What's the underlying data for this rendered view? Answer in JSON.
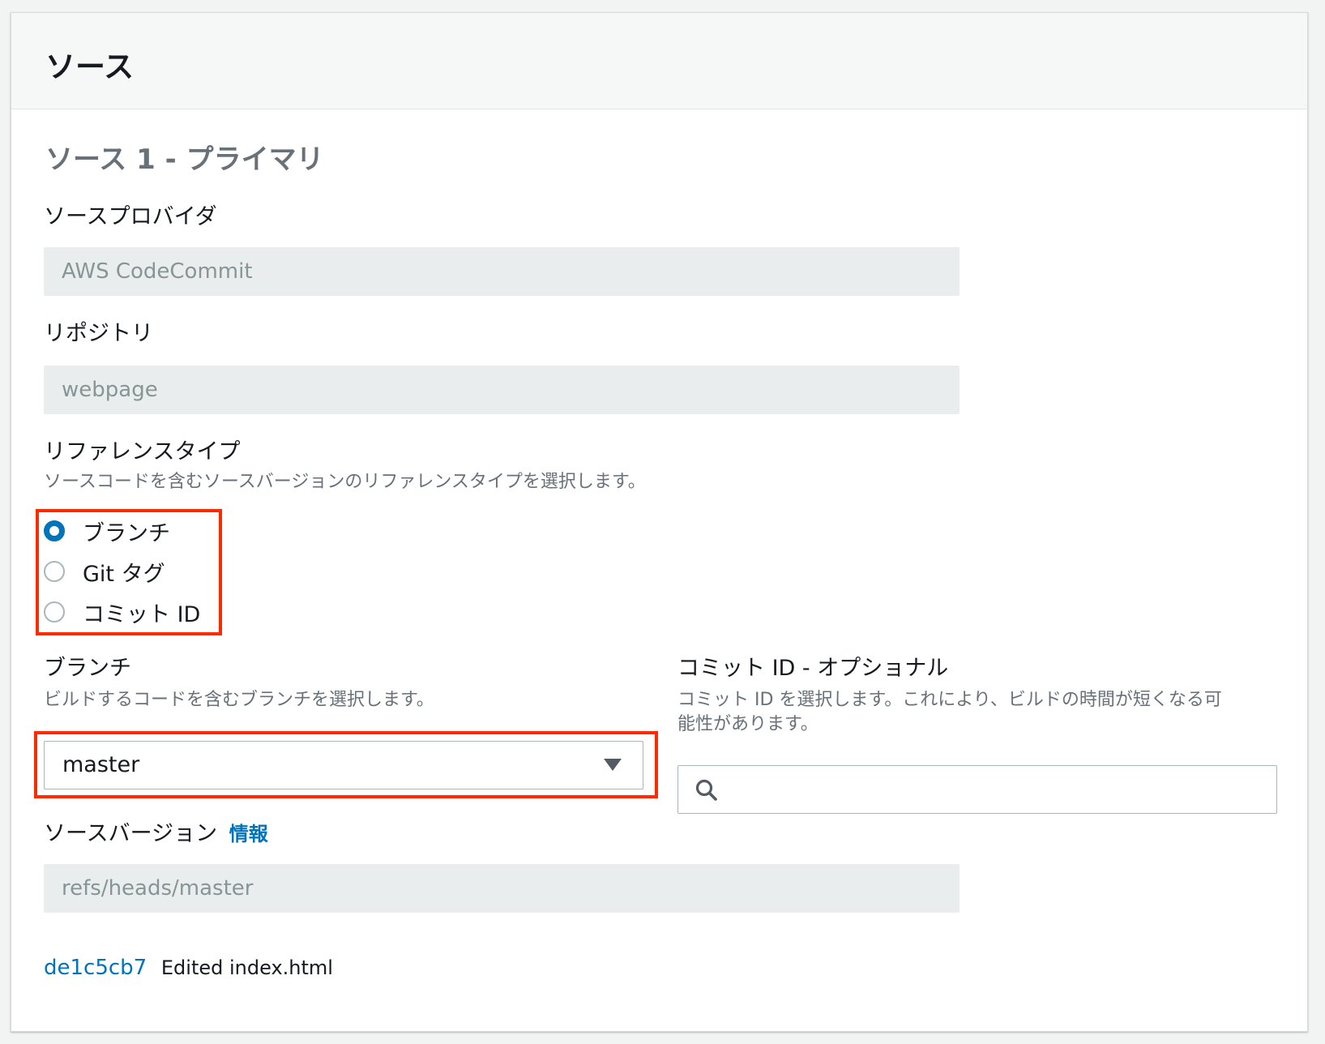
{
  "panel": {
    "title": "ソース"
  },
  "section": {
    "title": "ソース 1 - プライマリ"
  },
  "source_provider": {
    "label": "ソースプロバイダ",
    "value": "AWS CodeCommit"
  },
  "repository": {
    "label": "リポジトリ",
    "value": "webpage"
  },
  "reference_type": {
    "label": "リファレンスタイプ",
    "description": "ソースコードを含むソースバージョンのリファレンスタイプを選択します。",
    "options": [
      {
        "label": "ブランチ",
        "selected": true
      },
      {
        "label": "Git タグ",
        "selected": false
      },
      {
        "label": "コミット ID",
        "selected": false
      }
    ]
  },
  "branch": {
    "label": "ブランチ",
    "description": "ビルドするコードを含むブランチを選択します。",
    "value": "master"
  },
  "commit_id": {
    "label": "コミット ID - オプショナル",
    "description_line1": "コミット ID を選択します。これにより、ビルドの時間が短くなる可",
    "description_line2": "能性があります。",
    "placeholder": ""
  },
  "source_version": {
    "label": "ソースバージョン",
    "info_link": "情報",
    "value": "refs/heads/master",
    "commit_hash": "de1c5cb7",
    "commit_message": "Edited index.html"
  },
  "colors": {
    "accent": "#0073bb",
    "highlight": "#ff2a00"
  },
  "icons": {
    "search": "search-icon",
    "dropdown": "caret-down-icon"
  }
}
